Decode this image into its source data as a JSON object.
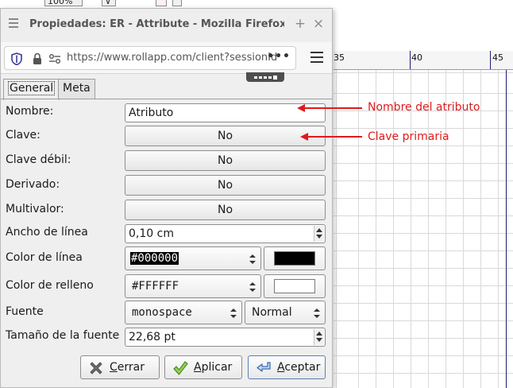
{
  "background": {
    "top_fragments": [
      "100%",
      "∨"
    ],
    "ruler_labels": [
      "35",
      "40",
      "45"
    ],
    "grid_color": "#d9d9d9",
    "page_border_color": "#1d1d6e"
  },
  "window": {
    "title": "Propiedades: ER - Attribute - Mozilla Firefox",
    "minimize_glyph": "+",
    "close_glyph": "×",
    "url": "https://www.rollapp.com/client?sessionId=",
    "more_glyph": "•••"
  },
  "tabs": [
    {
      "label": "General",
      "active": true
    },
    {
      "label": "Meta",
      "active": false
    }
  ],
  "form": {
    "nombre": {
      "label": "Nombre:",
      "value": "Atributo"
    },
    "clave": {
      "label": "Clave:",
      "value": "No"
    },
    "clave_debil": {
      "label": "Clave débil:",
      "value": "No"
    },
    "derivado": {
      "label": "Derivado:",
      "value": "No"
    },
    "multivalor": {
      "label": "Multivalor:",
      "value": "No"
    },
    "ancho_linea": {
      "label": "Ancho de línea",
      "value": "0,10 cm"
    },
    "color_linea": {
      "label": "Color de línea",
      "value": "#000000",
      "swatch": "#000000"
    },
    "color_relleno": {
      "label": "Color de relleno",
      "value": "#FFFFFF",
      "swatch": "#FFFFFF"
    },
    "fuente": {
      "label": "Fuente",
      "family": "monospace",
      "style": "Normal"
    },
    "tamano_fuente": {
      "label": "Tamaño de la fuente",
      "value": "22,68 pt"
    }
  },
  "actions": {
    "cerrar": {
      "prefix": "",
      "mnemonic": "C",
      "rest": "errar"
    },
    "aplicar": {
      "prefix": "",
      "mnemonic": "A",
      "rest": "plicar"
    },
    "aceptar": {
      "prefix": "",
      "mnemonic": "A",
      "rest": "ceptar"
    }
  },
  "annotations": {
    "color": "#e0191c",
    "nombre_note": "Nombre del atributo",
    "clave_note": "Clave primaria"
  }
}
